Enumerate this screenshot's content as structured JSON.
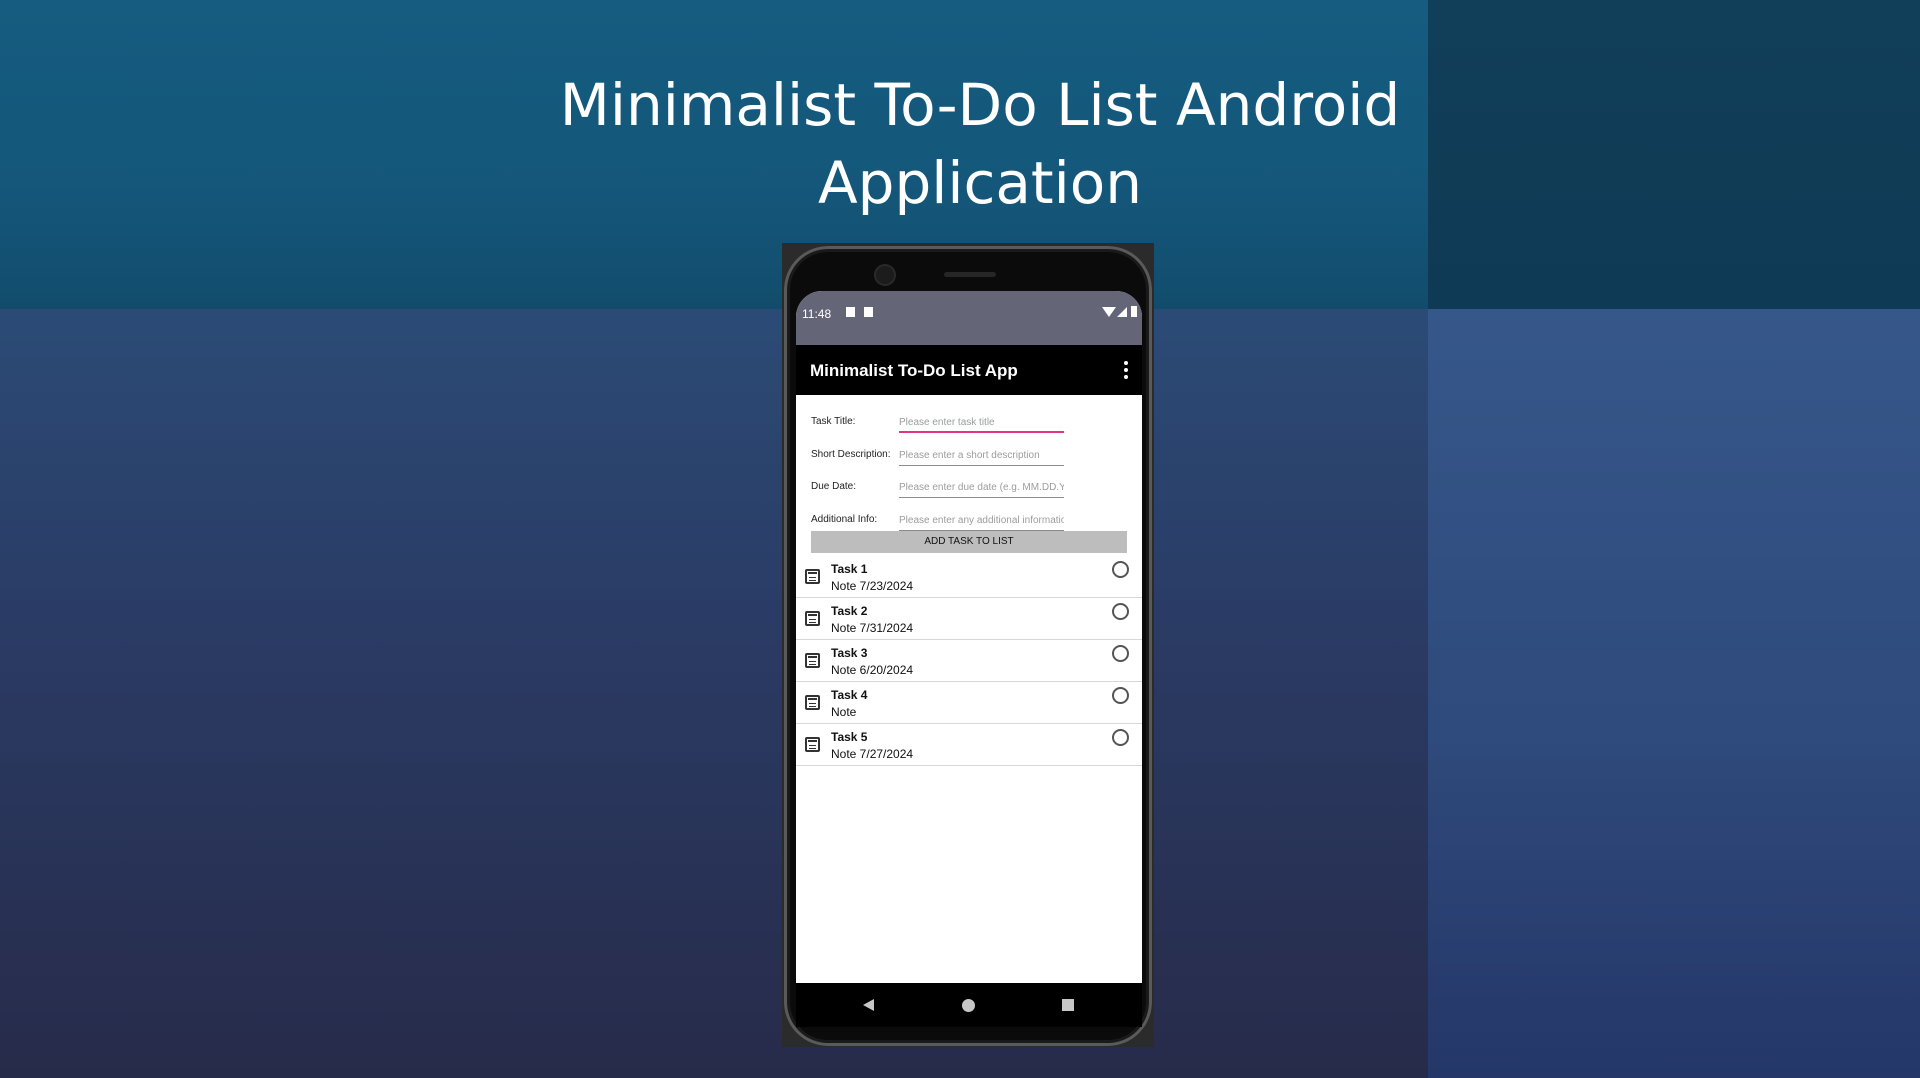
{
  "slide": {
    "title_line1": "Minimalist To-Do List Android",
    "title_line2": "Application"
  },
  "status_bar": {
    "time": "11:48",
    "icons": [
      "notification-icon",
      "sd-card-icon",
      "wifi-icon",
      "cell-signal-icon",
      "battery-icon"
    ]
  },
  "app_bar": {
    "title": "Minimalist To-Do List App",
    "menu_icon": "overflow-menu-icon"
  },
  "form": {
    "fields": [
      {
        "label": "Task Title:",
        "placeholder": "Please enter task title",
        "value": ""
      },
      {
        "label": "Short Description:",
        "placeholder": "Please enter a short description",
        "value": ""
      },
      {
        "label": "Due Date:",
        "placeholder": "Please enter due date (e.g. MM.DD.YY)",
        "value": ""
      },
      {
        "label": "Additional Info:",
        "placeholder": "Please enter any additional information",
        "value": ""
      }
    ],
    "add_button": "ADD TASK TO LIST"
  },
  "tasks": [
    {
      "title": "Task 1",
      "note": "Note  7/23/2024",
      "icon": "calendar-icon"
    },
    {
      "title": "Task 2",
      "note": "Note  7/31/2024",
      "icon": "calendar-icon"
    },
    {
      "title": "Task 3",
      "note": "Note  6/20/2024",
      "icon": "calendar-icon"
    },
    {
      "title": "Task 4",
      "note": "Note",
      "icon": "calendar-icon"
    },
    {
      "title": "Task 5",
      "note": "Note  7/27/2024",
      "icon": "calendar-icon"
    }
  ],
  "nav_bar": {
    "icons": [
      "back-icon",
      "home-icon",
      "recents-icon"
    ]
  },
  "colors": {
    "status_bar": "#656578",
    "app_bar": "#000000",
    "focus_accent": "#e0338a",
    "button": "#bdbdbd"
  }
}
